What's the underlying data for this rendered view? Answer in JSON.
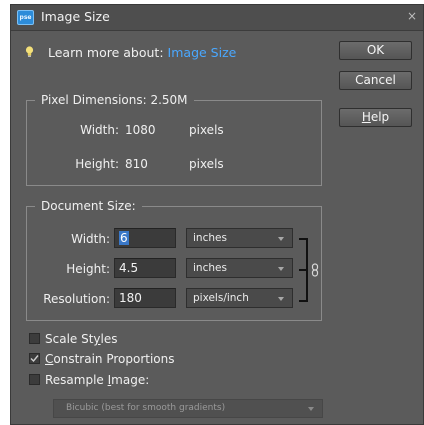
{
  "window": {
    "title": "Image Size",
    "close_glyph": "×",
    "icon_text": "pse",
    "icon": "photoshop-elements-icon"
  },
  "learn": {
    "prefix": "Learn more about:",
    "link": "Image Size",
    "icon": "lightbulb-icon"
  },
  "buttons": {
    "ok": "OK",
    "cancel": "Cancel",
    "help_mnemonic": "H",
    "help_rest": "elp"
  },
  "pixel_dimensions": {
    "title": "Pixel Dimensions:  2.50M",
    "width_label": "Width:",
    "width_value": "1080",
    "width_unit": "pixels",
    "height_label": "Height:",
    "height_value": "810",
    "height_unit": "pixels"
  },
  "document_size": {
    "title": "Document Size:",
    "width_label": "Width:",
    "width_value": "6",
    "width_unit": "inches",
    "height_label": "Height:",
    "height_value": "4.5",
    "height_unit": "inches",
    "resolution_label": "Resolution:",
    "resolution_value": "180",
    "resolution_unit": "pixels/inch",
    "link_icon": "chain-link-icon"
  },
  "options": {
    "scale_styles_pre": "Scale St",
    "scale_styles_mn": "y",
    "scale_styles_post": "les",
    "scale_styles_checked": false,
    "constrain_mn": "C",
    "constrain_post": "onstrain Proportions",
    "constrain_checked": true,
    "resample_pre": "Resample ",
    "resample_mn": "I",
    "resample_post": "mage:",
    "resample_checked": false
  },
  "resample_method": "Bicubic (best for smooth gradients)",
  "colors": {
    "dialog_bg": "#5b5b5b",
    "link": "#4aa8ff",
    "selection": "#3a78c8"
  }
}
